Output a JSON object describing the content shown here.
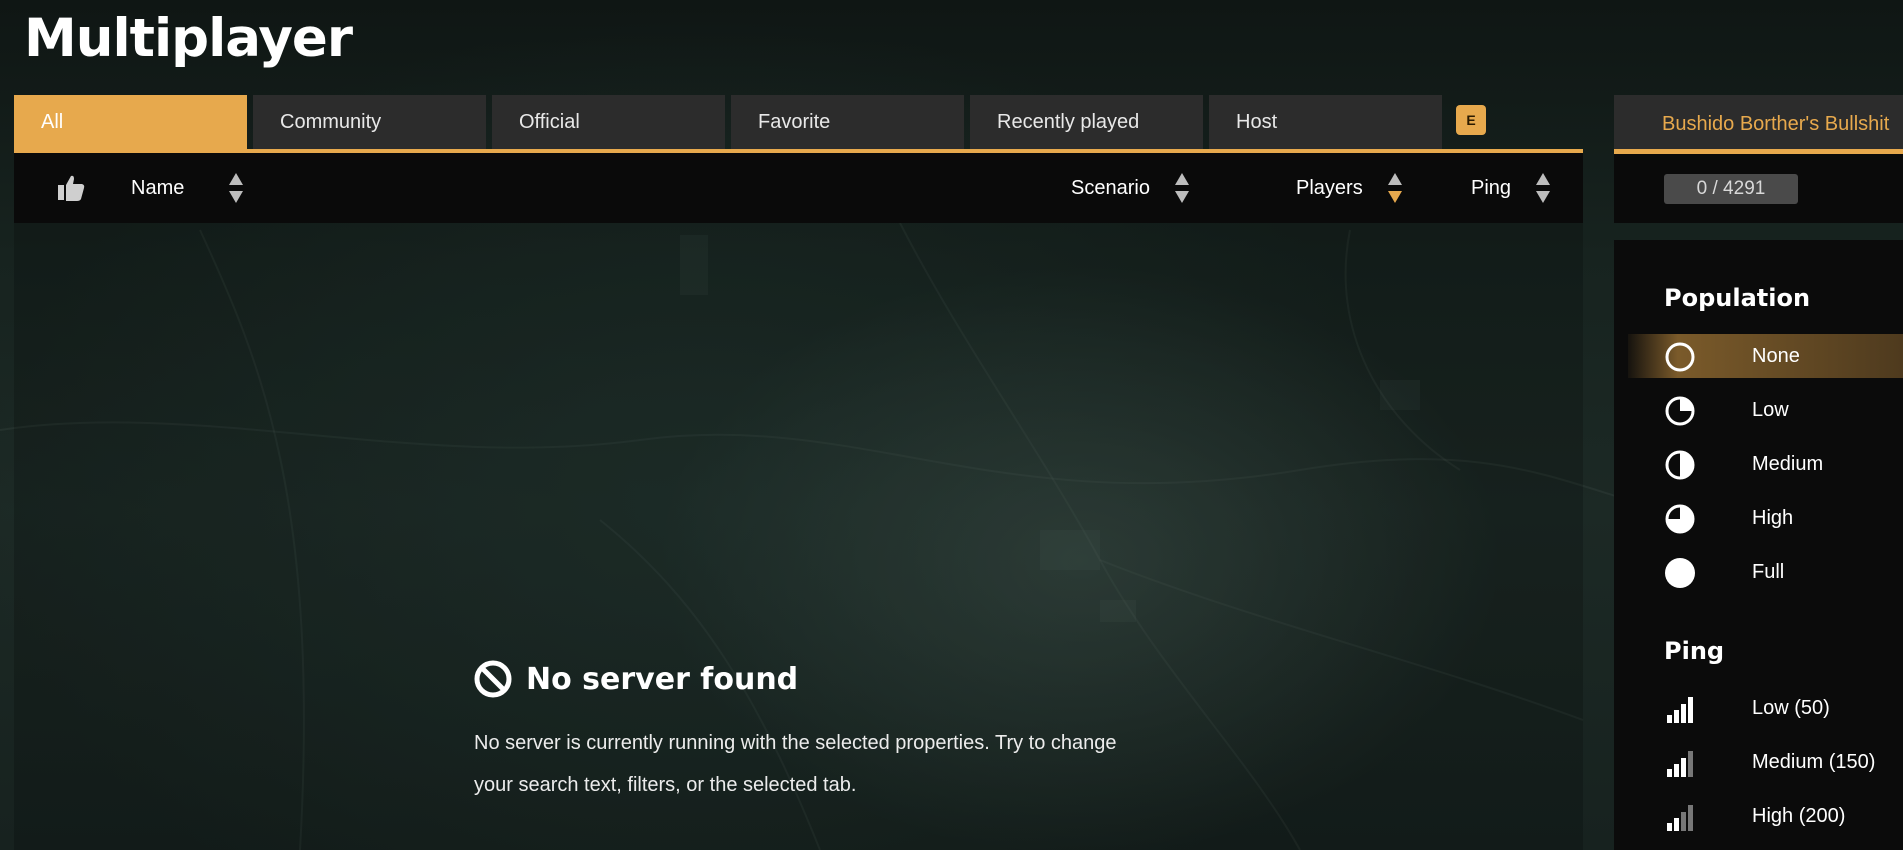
{
  "page": {
    "title": "Multiplayer"
  },
  "tabs": [
    {
      "label": "All",
      "active": true
    },
    {
      "label": "Community",
      "active": false
    },
    {
      "label": "Official",
      "active": false
    },
    {
      "label": "Favorite",
      "active": false
    },
    {
      "label": "Recently played",
      "active": false
    },
    {
      "label": "Host",
      "active": false
    }
  ],
  "tabs_key_hint": "E",
  "columns": {
    "name": "Name",
    "scenario": "Scenario",
    "players": "Players",
    "ping": "Ping",
    "active_sort": "players"
  },
  "right_panel": {
    "selected_server": "Bushido Borther's Bullshit",
    "server_count": "0 / 4291"
  },
  "empty_state": {
    "title": "No server found",
    "message": "No server is currently running with the selected properties. Try to change your search text, filters, or the selected tab."
  },
  "filters": {
    "population": {
      "heading": "Population",
      "options": [
        {
          "label": "None",
          "icon": "population-none-icon",
          "selected": true
        },
        {
          "label": "Low",
          "icon": "population-low-icon",
          "selected": false
        },
        {
          "label": "Medium",
          "icon": "population-medium-icon",
          "selected": false
        },
        {
          "label": "High",
          "icon": "population-high-icon",
          "selected": false
        },
        {
          "label": "Full",
          "icon": "population-full-icon",
          "selected": false
        }
      ]
    },
    "ping": {
      "heading": "Ping",
      "options": [
        {
          "label": "Low (50)",
          "icon": "signal-bars-icon",
          "level": 4
        },
        {
          "label": "Medium (150)",
          "icon": "signal-bars-icon",
          "level": 3
        },
        {
          "label": "High (200)",
          "icon": "signal-bars-icon",
          "level": 2
        }
      ]
    }
  },
  "colors": {
    "accent": "#e7a94d",
    "tab_bg": "#2c2c2c",
    "header_bg": "#0a0a0a"
  }
}
